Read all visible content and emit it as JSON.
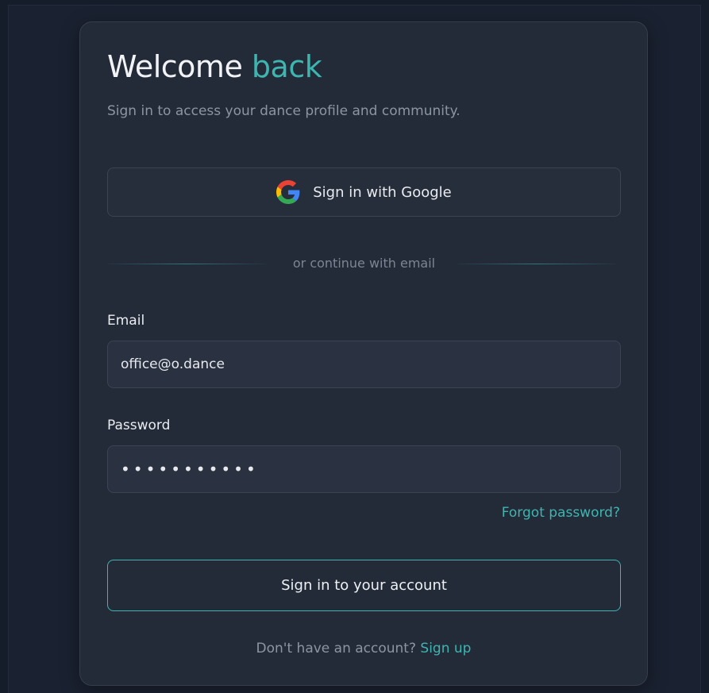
{
  "login": {
    "title_main": "Welcome",
    "title_accent": "back",
    "subtitle": "Sign in to access your dance profile and community.",
    "google_button_label": "Sign in with Google",
    "divider_text": "or continue with email",
    "email_label": "Email",
    "email_value": "office@o.dance",
    "password_label": "Password",
    "password_value": "•••••••••••",
    "forgot_password_label": "Forgot password?",
    "submit_label": "Sign in to your account",
    "signup_prompt": "Don't have an account?",
    "signup_link_label": "Sign up"
  },
  "icons": {
    "google": "google-g-icon"
  },
  "colors": {
    "accent": "#3fb5b0",
    "background": "#161d2a",
    "card": "#232a38",
    "input": "#2a3140"
  }
}
